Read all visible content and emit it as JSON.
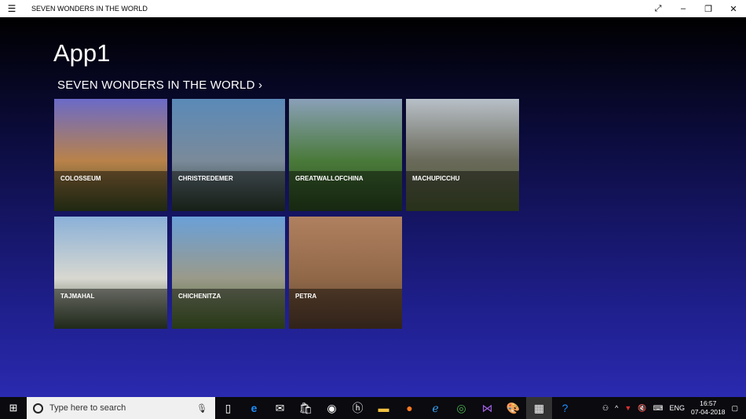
{
  "window": {
    "title": "SEVEN WONDERS IN THE WORLD",
    "menu_icon": "hamburger-icon",
    "controls": [
      "expand-icon",
      "minimize-icon",
      "restore-icon",
      "close-icon"
    ]
  },
  "app": {
    "title": "App1",
    "section_header": "SEVEN WONDERS IN THE WORLD ›"
  },
  "tiles": [
    {
      "label": "COLOSSEUM",
      "colors": [
        "#6a6ac8",
        "#b9824a",
        "#3a4a20"
      ]
    },
    {
      "label": "CHRISTREDEMER",
      "colors": [
        "#5a8ab8",
        "#7a8a9a",
        "#2a3a2a"
      ]
    },
    {
      "label": "GREATWALLOFCHINA",
      "colors": [
        "#8aa0b8",
        "#4a7a3a",
        "#2a4a20"
      ]
    },
    {
      "label": "MACHUPICCHU",
      "colors": [
        "#b8c0c8",
        "#6a6a5a",
        "#4a5a30"
      ]
    },
    {
      "label": "TAJMAHAL",
      "colors": [
        "#8ab0d8",
        "#d8d8d0",
        "#3a4a30"
      ]
    },
    {
      "label": "CHICHENITZA",
      "colors": [
        "#6aa0d8",
        "#9a9a8a",
        "#4a6a2a"
      ]
    },
    {
      "label": "PETRA",
      "colors": [
        "#b08060",
        "#906848",
        "#5a4030"
      ]
    }
  ],
  "taskbar": {
    "search_placeholder": "Type here to search",
    "time": "16:57",
    "date": "07-04-2018",
    "language": "ENG"
  }
}
